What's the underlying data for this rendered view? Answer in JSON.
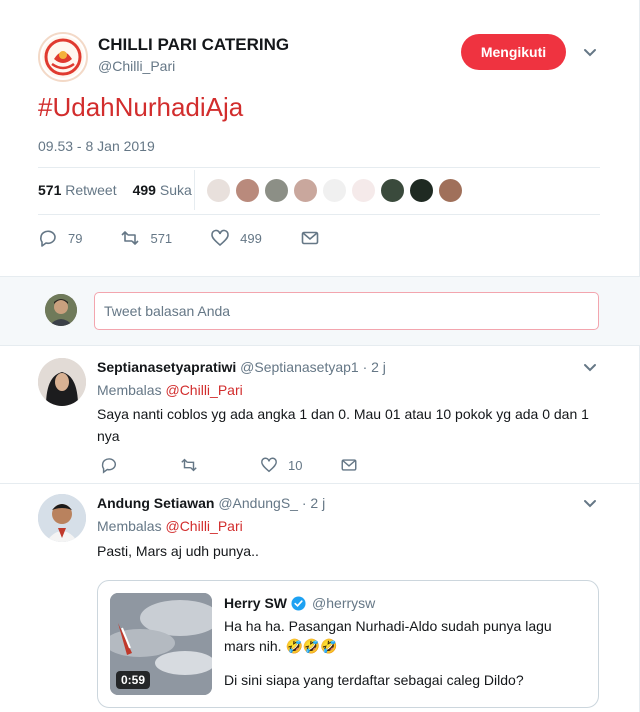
{
  "main_tweet": {
    "name": "CHILLI PARI CATERING",
    "handle": "@Chilli_Pari",
    "follow_label": "Mengikuti",
    "hashtag": "#UdahNurhadiAja",
    "timestamp": "09.53 - 8 Jan 2019",
    "retweet_count": "571",
    "retweet_label": "Retweet",
    "like_count": "499",
    "like_label": "Suka",
    "actions": {
      "reply_count": "79",
      "retweet_count": "571",
      "like_count": "499"
    }
  },
  "reply_box": {
    "placeholder": "Tweet balasan Anda"
  },
  "replies": [
    {
      "name": "Septianasetyapratiwi",
      "handle": "@Septianasetyap1",
      "time": "· 2 j",
      "replying_label": "Membalas",
      "replying_to": "@Chilli_Pari",
      "text": "Saya nanti coblos yg ada angka 1 dan 0. Mau 01 atau 10 pokok yg ada 0 dan 1 nya",
      "like_count": "10"
    },
    {
      "name": "Andung Setiawan",
      "handle": "@AndungS_",
      "time": "· 2 j",
      "replying_label": "Membalas",
      "replying_to": "@Chilli_Pari",
      "text": "Pasti, Mars aj udh punya.."
    }
  ],
  "quote": {
    "name": "Herry SW",
    "handle": "@herrysw",
    "text_line1": "Ha ha ha. Pasangan Nurhadi-Aldo sudah punya lagu mars nih. 🤣🤣🤣",
    "text_line2": "Di sini siapa yang terdaftar sebagai caleg Dildo?",
    "video_duration": "0:59"
  },
  "colors": {
    "accent_red": "#d22d2d",
    "follow_button": "#ef3340",
    "muted": "#657786",
    "verified": "#1da1f2"
  }
}
